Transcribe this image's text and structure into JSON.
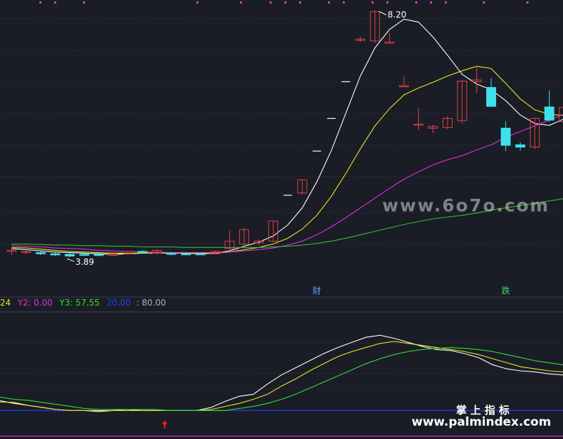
{
  "chart_data": [
    {
      "type": "candlestick",
      "colors": {
        "up": "#e04040",
        "down": "#3fe0ec",
        "grid": "#3c4050",
        "dot": "#d040d0"
      },
      "ylim": [
        3.5,
        8.35
      ],
      "price_annotations": {
        "high_label": "8.20",
        "low_label": "3.89"
      },
      "event_markers": [
        {
          "label": "财",
          "color": "#5aa8ff",
          "at_index": 21
        },
        {
          "label": "跌",
          "color": "#3fdc6a",
          "at_index": 34
        }
      ],
      "candles": [
        {
          "o": 3.99,
          "h": 4.03,
          "l": 3.93,
          "c": 4.01
        },
        {
          "o": 3.97,
          "h": 4.01,
          "l": 3.94,
          "c": 3.99
        },
        {
          "o": 3.97,
          "h": 3.99,
          "l": 3.93,
          "c": 3.95
        },
        {
          "o": 3.95,
          "h": 3.97,
          "l": 3.91,
          "c": 3.93
        },
        {
          "o": 3.94,
          "h": 3.96,
          "l": 3.89,
          "c": 3.91
        },
        {
          "o": 3.94,
          "h": 3.96,
          "l": 3.92,
          "c": 3.93
        },
        {
          "o": 3.94,
          "h": 3.97,
          "l": 3.91,
          "c": 3.92
        },
        {
          "o": 3.93,
          "h": 3.95,
          "l": 3.91,
          "c": 3.94
        },
        {
          "o": 3.95,
          "h": 4.0,
          "l": 3.93,
          "c": 3.99
        },
        {
          "o": 3.99,
          "h": 4.01,
          "l": 3.96,
          "c": 3.97
        },
        {
          "o": 3.96,
          "h": 4.03,
          "l": 3.94,
          "c": 4.01
        },
        {
          "o": 3.96,
          "h": 3.98,
          "l": 3.92,
          "c": 3.94
        },
        {
          "o": 3.95,
          "h": 3.97,
          "l": 3.93,
          "c": 3.94
        },
        {
          "o": 3.95,
          "h": 3.97,
          "l": 3.93,
          "c": 3.94
        },
        {
          "o": 3.95,
          "h": 4.01,
          "l": 3.94,
          "c": 3.99
        },
        {
          "o": 4.04,
          "h": 4.35,
          "l": 4.02,
          "c": 4.17
        },
        {
          "o": 4.12,
          "h": 4.4,
          "l": 4.08,
          "c": 4.37
        },
        {
          "o": 4.14,
          "h": 4.2,
          "l": 4.1,
          "c": 4.17
        },
        {
          "o": 4.17,
          "h": 4.52,
          "l": 4.15,
          "c": 4.52
        },
        {
          "o": 4.97,
          "h": 4.97,
          "l": 4.97,
          "c": 4.97
        },
        {
          "o": 5.01,
          "h": 5.25,
          "l": 4.98,
          "c": 5.24
        },
        {
          "o": 5.74,
          "h": 5.74,
          "l": 5.74,
          "c": 5.74
        },
        {
          "o": 6.31,
          "h": 6.31,
          "l": 6.31,
          "c": 6.31
        },
        {
          "o": 6.95,
          "h": 6.95,
          "l": 6.95,
          "c": 6.95
        },
        {
          "o": 7.69,
          "h": 7.74,
          "l": 7.64,
          "c": 7.69
        },
        {
          "o": 7.66,
          "h": 8.2,
          "l": 7.62,
          "c": 8.17
        },
        {
          "o": 7.64,
          "h": 7.8,
          "l": 7.64,
          "c": 7.64
        },
        {
          "o": 6.88,
          "h": 7.04,
          "l": 6.88,
          "c": 6.88
        },
        {
          "o": 6.2,
          "h": 6.49,
          "l": 6.1,
          "c": 6.21
        },
        {
          "o": 6.14,
          "h": 6.2,
          "l": 6.05,
          "c": 6.17
        },
        {
          "o": 6.15,
          "h": 6.35,
          "l": 6.12,
          "c": 6.31
        },
        {
          "o": 6.27,
          "h": 6.98,
          "l": 6.22,
          "c": 6.96
        },
        {
          "o": 6.95,
          "h": 7.23,
          "l": 6.75,
          "c": 6.98
        },
        {
          "o": 6.85,
          "h": 7.01,
          "l": 6.52,
          "c": 6.52
        },
        {
          "o": 6.14,
          "h": 6.26,
          "l": 5.74,
          "c": 5.84
        },
        {
          "o": 5.85,
          "h": 5.89,
          "l": 5.75,
          "c": 5.81
        },
        {
          "o": 5.81,
          "h": 6.32,
          "l": 5.77,
          "c": 6.31
        },
        {
          "o": 6.51,
          "h": 6.8,
          "l": 6.25,
          "c": 6.28
        },
        {
          "o": 6.25,
          "h": 6.6,
          "l": 6.2,
          "c": 6.5
        },
        {
          "o": 6.5,
          "h": 6.76,
          "l": 6.33,
          "c": 6.61
        }
      ],
      "moving_averages": [
        {
          "color": "#ffffff",
          "values": [
            4.04,
            4.02,
            4.0,
            3.98,
            3.97,
            3.96,
            3.95,
            3.94,
            3.95,
            3.96,
            3.96,
            3.96,
            3.96,
            3.95,
            3.96,
            4.0,
            4.08,
            4.15,
            4.26,
            4.45,
            4.75,
            5.2,
            5.75,
            6.4,
            7.05,
            7.54,
            7.86,
            8.04,
            7.99,
            7.73,
            7.41,
            7.08,
            6.91,
            6.81,
            6.62,
            6.37,
            6.22,
            6.19,
            6.3,
            6.41
          ]
        },
        {
          "color": "#e8e820",
          "values": [
            4.06,
            4.05,
            4.03,
            4.01,
            3.99,
            3.98,
            3.97,
            3.96,
            3.96,
            3.96,
            3.96,
            3.96,
            3.96,
            3.96,
            3.96,
            3.98,
            4.02,
            4.06,
            4.12,
            4.22,
            4.38,
            4.62,
            4.95,
            5.35,
            5.78,
            6.18,
            6.48,
            6.72,
            6.84,
            6.94,
            7.05,
            7.14,
            7.22,
            7.18,
            6.92,
            6.65,
            6.46,
            6.38,
            6.36,
            6.38
          ]
        },
        {
          "color": "#e030e0",
          "values": [
            4.09,
            4.08,
            4.07,
            4.05,
            4.04,
            4.03,
            4.01,
            4.0,
            3.99,
            3.98,
            3.98,
            3.97,
            3.97,
            3.97,
            3.97,
            3.98,
            4.0,
            4.02,
            4.05,
            4.1,
            4.17,
            4.28,
            4.42,
            4.58,
            4.75,
            4.92,
            5.09,
            5.25,
            5.38,
            5.5,
            5.59,
            5.66,
            5.76,
            5.85,
            5.98,
            6.08,
            6.18,
            6.28,
            6.38,
            6.48
          ]
        },
        {
          "color": "#30c030",
          "values": [
            4.12,
            4.12,
            4.11,
            4.1,
            4.1,
            4.09,
            4.09,
            4.08,
            4.08,
            4.07,
            4.07,
            4.07,
            4.06,
            4.06,
            4.06,
            4.06,
            4.06,
            4.06,
            4.07,
            4.08,
            4.1,
            4.13,
            4.17,
            4.22,
            4.28,
            4.34,
            4.4,
            4.46,
            4.51,
            4.56,
            4.59,
            4.62,
            4.66,
            4.71,
            4.75,
            4.79,
            4.83,
            4.87,
            4.91,
            4.95
          ]
        }
      ]
    },
    {
      "type": "line",
      "ylim": [
        -5,
        100
      ],
      "legend": [
        {
          "text": "24",
          "color": "#e8e820"
        },
        {
          "text": "Y2: 0.00",
          "color": "#e030e0"
        },
        {
          "text": "Y3: 57.55",
          "color": "#30e030"
        },
        {
          "text": "20.00",
          "color": "#2a3cff"
        },
        {
          "text": ": 80.00",
          "color": "#b4b4b4"
        }
      ],
      "reference_line": {
        "value": 3,
        "color": "#2436d8"
      },
      "signal": {
        "color": "#ff2020",
        "at_index": 11.7
      },
      "series": [
        {
          "color": "#ffffff",
          "values": [
            12.6,
            10,
            8,
            6,
            4,
            3,
            3,
            2,
            3,
            4,
            3,
            3,
            3,
            3,
            3,
            6,
            12,
            17,
            19,
            29,
            38,
            45,
            52,
            59,
            65,
            70,
            75,
            77,
            74,
            70,
            66,
            63,
            62,
            59,
            55,
            48,
            44,
            42,
            41,
            39,
            38
          ]
        },
        {
          "color": "#e8e820",
          "values": [
            11.4,
            11,
            8,
            6,
            4,
            3,
            3,
            3,
            3,
            3,
            3,
            3,
            3,
            3,
            3,
            4,
            7,
            10,
            14,
            19,
            27,
            34,
            42,
            49,
            56,
            61,
            65,
            69,
            71,
            69,
            67,
            65,
            63,
            61,
            58,
            54,
            50,
            46,
            44,
            42,
            41
          ]
        },
        {
          "color": "#30e030",
          "values": [
            16.2,
            14,
            13,
            11,
            9,
            7,
            5,
            4,
            4,
            4,
            4,
            4,
            3,
            3,
            3,
            3,
            3,
            5,
            7,
            10,
            14,
            19,
            25,
            31,
            37,
            43,
            49,
            54,
            58,
            61,
            63,
            64,
            65,
            64,
            63,
            61,
            58,
            55,
            52,
            50,
            48
          ]
        }
      ]
    }
  ],
  "watermarks": {
    "top": "www.6o7o.com",
    "bottom_cn": "掌 上 指 标",
    "bottom_url": "www.palmindex.com"
  }
}
